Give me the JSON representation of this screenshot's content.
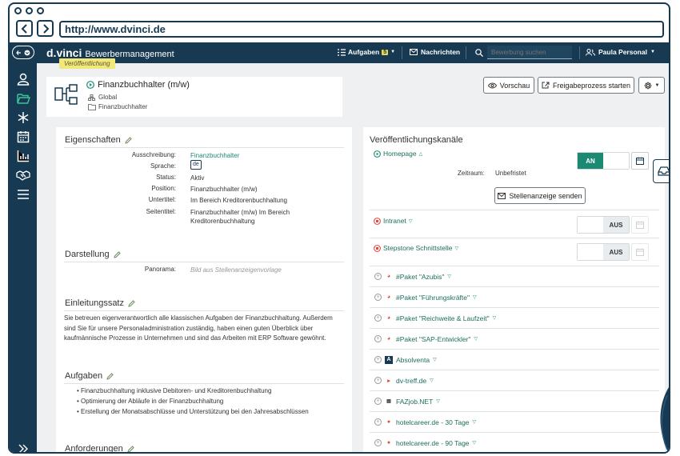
{
  "browser": {
    "url": "http://www.dvinci.de"
  },
  "app": {
    "logo": "d.vinci",
    "product": "Bewerbermanagement",
    "badge": "Veröffentlichung"
  },
  "topnav": {
    "tasks_label": "Aufgaben",
    "tasks_count": "5",
    "messages_label": "Nachrichten",
    "search_placeholder": "Bewerbung suchen",
    "user_label": "Paula Personal"
  },
  "job": {
    "title": "Finanzbuchhalter (m/w)",
    "scope": "Global",
    "folder": "Finanzbuchhalter"
  },
  "actions": {
    "preview": "Vorschau",
    "release": "Freigabeprozess starten"
  },
  "left": {
    "properties_title": "Eigenschaften",
    "properties": [
      {
        "label": "Ausschreibung:",
        "value": "Finanzbuchhalter"
      },
      {
        "label": "Sprache:",
        "value": "de"
      },
      {
        "label": "Status:",
        "value": "Aktiv"
      },
      {
        "label": "Position:",
        "value": "Finanzbuchhalter (m/w)"
      },
      {
        "label": "Untertitel:",
        "value": "Im Bereich Kreditorenbuchhaltung"
      },
      {
        "label": "Seitentitel:",
        "value": "Finanzbuchhalter (m/w) Im Bereich Kreditorenbuchhaltung"
      }
    ],
    "display_title": "Darstellung",
    "panorama_label": "Panorama:",
    "panorama_value": "Bild aus Stellenanzeigenvorlage",
    "intro_title": "Einleitungssatz",
    "intro_text": "Sie betreuen eigenverantwortlich alle klassischen Aufgaben der Finanzbuchhaltung. Außerdem sind Sie für unsere Personaladministration zuständig, haben einen guten Überblick über kaufmännische Prozesse in Unternehmen und sind das Arbeiten mit ERP Software gewöhnt.",
    "tasks_title": "Aufgaben",
    "tasks": [
      "Finanzbuchhaltung inklusive Debitoren- und Kreditorenbuchhaltung",
      "Optimierung der Abläufe in der Finanzbuchhaltung",
      "Erstellung der Monatsabschlüsse und Unterstützung bei den Jahresabschlüssen"
    ],
    "requirements_title": "Anforderungen"
  },
  "right": {
    "channels_title": "Veröffentlichungskanäle",
    "homepage": {
      "name": "Homepage",
      "toggle": "AN",
      "period_label": "Zeitraum:",
      "period_value": "Unbefristet",
      "send_button": "Stellenanzeige senden"
    },
    "intranet": {
      "name": "Intranet",
      "toggle": "AUS"
    },
    "stepstone": {
      "name": "Stepstone Schnittstelle",
      "toggle": "AUS"
    },
    "channels": [
      "#Paket \"Azubis\"",
      "#Paket \"Führungskräfte\"",
      "#Paket \"Reichweite & Laufzeit\"",
      "#Paket \"SAP-Entwickler\"",
      "Absolventa",
      "dv-treff.de",
      "FAZjob.NET",
      "hotelcareer.de - 30 Tage",
      "hotelcareer.de - 90 Tage"
    ]
  },
  "colors": {
    "navy": "#173a52",
    "green": "#1a8a73",
    "accent_yellow": "#e8d44d"
  }
}
